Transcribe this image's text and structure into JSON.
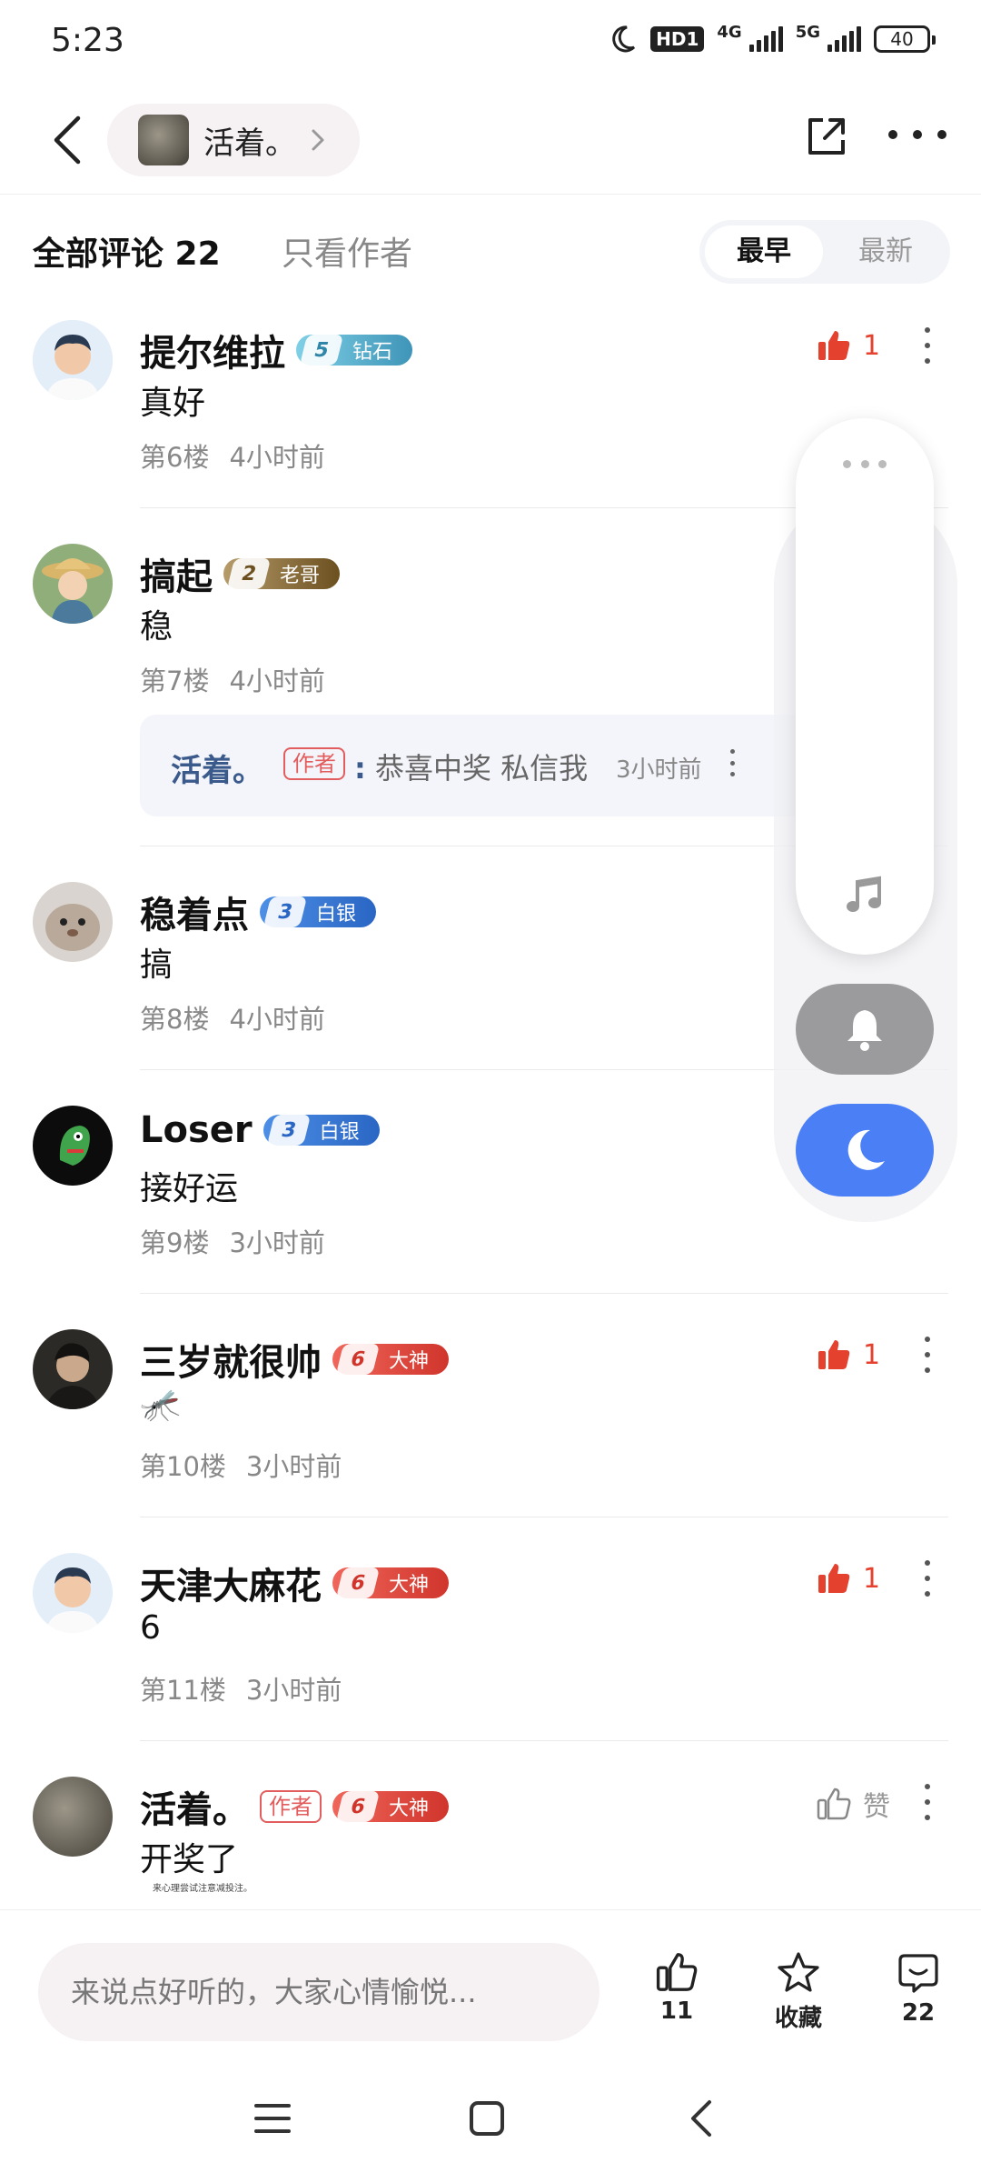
{
  "status_bar": {
    "time": "5:23",
    "hd": "HD1",
    "net1": "4G",
    "net2": "5G",
    "battery": "40"
  },
  "header": {
    "title": "活着。"
  },
  "filter": {
    "all_label": "全部评论 22",
    "author_label": "只看作者",
    "sort_earliest": "最早",
    "sort_latest": "最新"
  },
  "comments": [
    {
      "user": "提尔维拉",
      "level_num": "5",
      "level_name": "钻石",
      "text": "真好",
      "floor": "第6楼",
      "time": "4小时前",
      "likes": "1"
    },
    {
      "user": "搞起",
      "level_num": "2",
      "level_name": "老哥",
      "text": "稳",
      "floor": "第7楼",
      "time": "4小时前",
      "reply": {
        "user": "活着。",
        "tag": "作者",
        "text": "恭喜中奖 私信我",
        "time": "3小时前"
      }
    },
    {
      "user": "稳着点",
      "level_num": "3",
      "level_name": "白银",
      "text": "搞",
      "floor": "第8楼",
      "time": "4小时前"
    },
    {
      "user": "Loser",
      "level_num": "3",
      "level_name": "白银",
      "text": "接好运",
      "floor": "第9楼",
      "time": "3小时前"
    },
    {
      "user": "三岁就很帅",
      "level_num": "6",
      "level_name": "大神",
      "text": "🦟",
      "floor": "第10楼",
      "time": "3小时前",
      "likes": "1"
    },
    {
      "user": "天津大麻花",
      "level_num": "6",
      "level_name": "大神",
      "text": "6",
      "floor": "第11楼",
      "time": "3小时前",
      "likes": "1"
    },
    {
      "user": "活着。",
      "tag": "作者",
      "level_num": "6",
      "level_name": "大神",
      "text": "开奖了",
      "like_label": "赞"
    }
  ],
  "truncated_text": "来心理尝试注意减投注。",
  "bottom_bar": {
    "input_placeholder": "来说点好听的，大家心情愉悦...",
    "like_count": "11",
    "fav_label": "收藏",
    "comment_count": "22"
  },
  "colors": {
    "like_red": "#e5412f",
    "accent_blue": "#4a7ff5",
    "author_red": "#e25d5d"
  }
}
